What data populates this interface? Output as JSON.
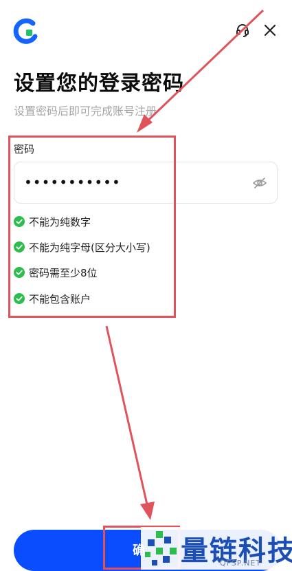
{
  "header": {
    "logo_icon": "app-logo",
    "support_icon": "headset-icon",
    "close_icon": "close-icon"
  },
  "page": {
    "title": "设置您的登录密码",
    "subtitle": "设置密码后即可完成账号注册"
  },
  "form": {
    "password_label": "密码",
    "password_value": "•••••••••••",
    "visibility_icon": "eye-off-icon"
  },
  "rules": [
    {
      "text": "不能为纯数字",
      "status": "passed"
    },
    {
      "text": "不能为纯字母(区分大小写)",
      "status": "passed"
    },
    {
      "text": "密码需至少8位",
      "status": "passed"
    },
    {
      "text": "不能包含账户",
      "status": "passed"
    }
  ],
  "footer": {
    "confirm_label": "确"
  },
  "watermark": {
    "brand": "量链科技",
    "domain": "QFSP.NET"
  },
  "colors": {
    "primary": "#0a4cff",
    "success": "#2dbd4e",
    "annotation": "#e0535b",
    "logo": "#1464ff",
    "logo_accent": "#21c16b"
  }
}
